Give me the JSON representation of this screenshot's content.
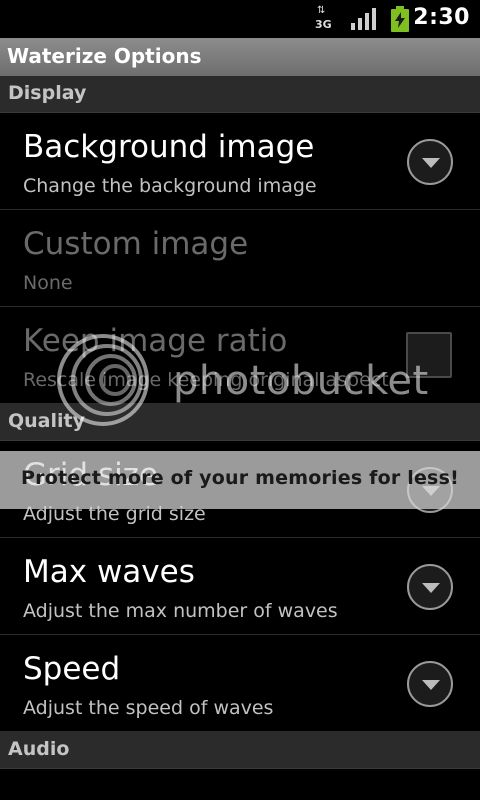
{
  "status_bar": {
    "network_type": "3G",
    "network_arrows": "⇅",
    "signal_icon": "signal-bars-icon",
    "battery_icon": "battery-charging-icon",
    "time": "2:30"
  },
  "title_bar": {
    "title": "Waterize Options"
  },
  "sections": {
    "display": {
      "header": "Display",
      "items": [
        {
          "title": "Background image",
          "summary": "Change the background image",
          "widget": "dropdown",
          "enabled": true
        },
        {
          "title": "Custom image",
          "summary": "None",
          "widget": "none",
          "enabled": false
        },
        {
          "title": "Keep image ratio",
          "summary": "Rescale image keeping original aspect",
          "widget": "checkbox",
          "checked": false,
          "enabled": false
        }
      ]
    },
    "quality": {
      "header": "Quality",
      "items": [
        {
          "title": "Grid size",
          "summary": "Adjust the grid size",
          "widget": "dropdown",
          "enabled": true
        },
        {
          "title": "Max waves",
          "summary": "Adjust the max number of waves",
          "widget": "dropdown",
          "enabled": true
        },
        {
          "title": "Speed",
          "summary": "Adjust the speed of waves",
          "widget": "dropdown",
          "enabled": true
        }
      ]
    },
    "audio": {
      "header": "Audio"
    }
  },
  "watermark": {
    "brand": "photobucket",
    "banner": "Protect more of your memories for less!"
  }
}
